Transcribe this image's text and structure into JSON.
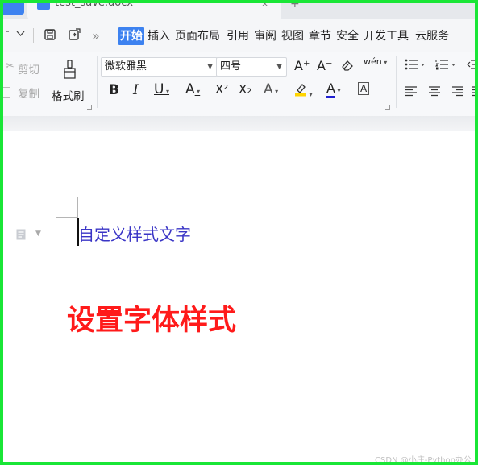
{
  "tabs": {
    "doc_title": "test_save.docx",
    "close_glyph": "×",
    "new_tab_glyph": "+"
  },
  "menubar": {
    "more_glyph": "»",
    "items": [
      "开始",
      "插入",
      "页面布局",
      "引用",
      "审阅",
      "视图",
      "章节",
      "安全",
      "开发工具",
      "云服务"
    ],
    "active_index": 0
  },
  "ribbon": {
    "cut_label": "剪切",
    "copy_label": "复制",
    "format_painter_label": "格式刷",
    "font_name": "微软雅黑",
    "font_size": "四号",
    "bold": "B",
    "italic": "I",
    "underline": "U",
    "strike": "A",
    "superscript": "X²",
    "subscript": "X₂",
    "text_effect": "A",
    "font_color": "A",
    "char_border": "A",
    "grow_font": "A⁺",
    "shrink_font": "A⁻",
    "pinyin": "wén"
  },
  "document": {
    "paragraph_text": "自定义样式文字",
    "big_title": "设置字体样式",
    "paragraph_color": "#3a35c6",
    "title_color": "#ff1a1a"
  },
  "watermark": "CSDN @小庄-Python办公",
  "colors": {
    "accent": "#3d82f0",
    "frame": "#19e636"
  }
}
